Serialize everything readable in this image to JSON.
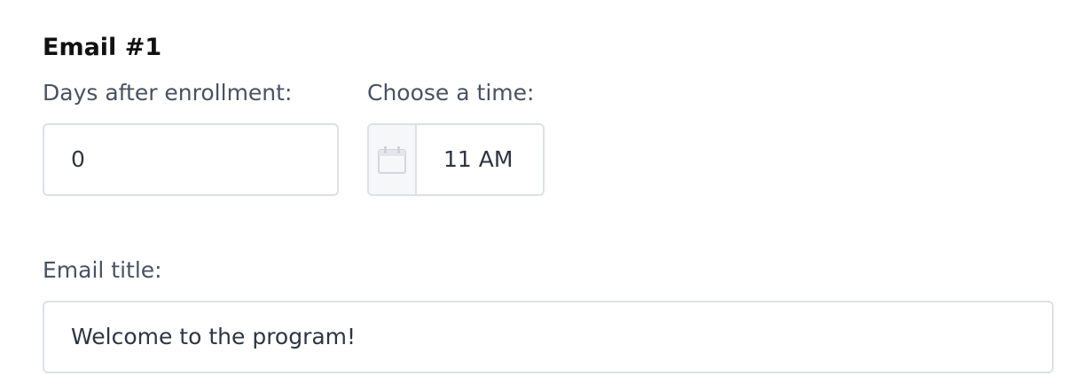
{
  "email": {
    "heading": "Email #1",
    "days_label": "Days after enrollment:",
    "days_value": "0",
    "time_label": "Choose a time:",
    "time_value": "11 AM",
    "time_icon": "calendar-icon",
    "title_label": "Email title:",
    "title_value": "Welcome to the program!"
  },
  "colors": {
    "border": "#dde0e5",
    "label": "#4a5261",
    "icon_bg": "#f6f7f9"
  }
}
